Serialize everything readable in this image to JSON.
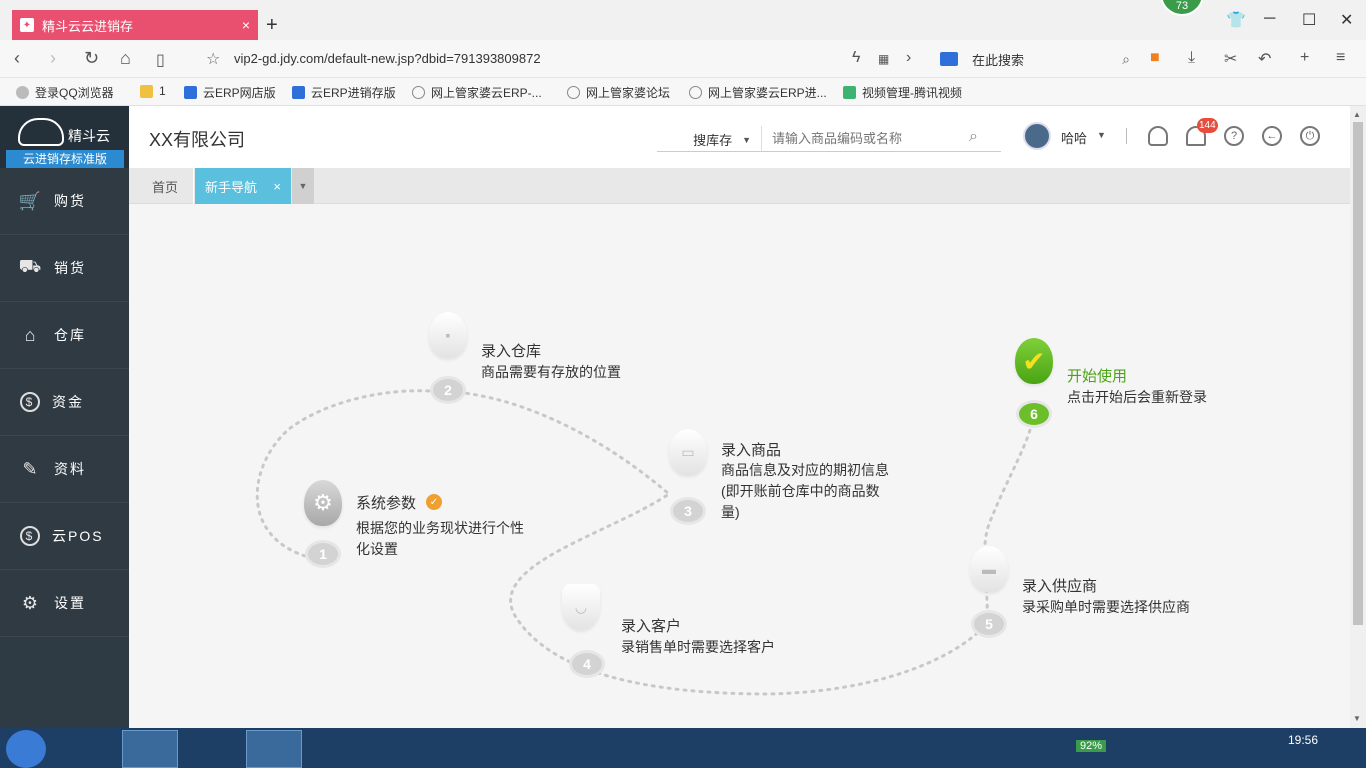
{
  "browser": {
    "tab_title": "精斗云云进销存",
    "tab_close": "×",
    "new_tab": "+",
    "badge": "73",
    "url": "vip2-gd.jdy.com/default-new.jsp?dbid=791393809872",
    "search_placeholder": "在此搜索",
    "bookmarks": [
      {
        "label": "登录QQ浏览器",
        "color": "#999999"
      },
      {
        "label": "1",
        "color": "#f0c040"
      },
      {
        "label": "云ERP网店版",
        "color": "#2e6fd9"
      },
      {
        "label": "云ERP进销存版",
        "color": "#2e6fd9"
      },
      {
        "label": "网上管家婆云ERP-...",
        "color": "#888888"
      },
      {
        "label": "网上管家婆论坛",
        "color": "#888888"
      },
      {
        "label": "网上管家婆云ERP进...",
        "color": "#888888"
      },
      {
        "label": "视频管理-腾讯视频",
        "color": "#3cb371"
      }
    ]
  },
  "app": {
    "brand": "精斗云",
    "edition": "云进销存标准版",
    "nav": [
      {
        "label": "购货",
        "icon": "cart-icon",
        "glyph": "🛒"
      },
      {
        "label": "销货",
        "icon": "trolley-icon",
        "glyph": "⛟"
      },
      {
        "label": "仓库",
        "icon": "warehouse-icon",
        "glyph": "⌂"
      },
      {
        "label": "资金",
        "icon": "dollar-icon",
        "glyph": "$"
      },
      {
        "label": "资料",
        "icon": "pencil-icon",
        "glyph": "✎"
      },
      {
        "label": "云POS",
        "icon": "pos-icon",
        "glyph": "$"
      },
      {
        "label": "设置",
        "icon": "gear-icon",
        "glyph": "⚙"
      }
    ],
    "company": "XX有限公司",
    "search_scope": "搜库存",
    "search_placeholder": "请输入商品编码或名称",
    "username": "哈哈",
    "notifications": "144",
    "tabs": {
      "home": "首页",
      "active": "新手导航",
      "close": "×"
    },
    "guide": {
      "steps": [
        {
          "num": "1",
          "title": "系统参数",
          "desc": "根据您的业务现状进行个性化设置"
        },
        {
          "num": "2",
          "title": "录入仓库",
          "desc": "商品需要有存放的位置"
        },
        {
          "num": "3",
          "title": "录入商品",
          "desc": "商品信息及对应的期初信息(即开账前仓库中的商品数量)"
        },
        {
          "num": "4",
          "title": "录入客户",
          "desc": "录销售单时需要选择客户"
        },
        {
          "num": "5",
          "title": "录入供应商",
          "desc": "录采购单时需要选择供应商"
        },
        {
          "num": "6",
          "title": "开始使用",
          "desc": "点击开始后会重新登录"
        }
      ]
    }
  },
  "taskbar": {
    "clock": "19:56",
    "battery": "92%"
  }
}
